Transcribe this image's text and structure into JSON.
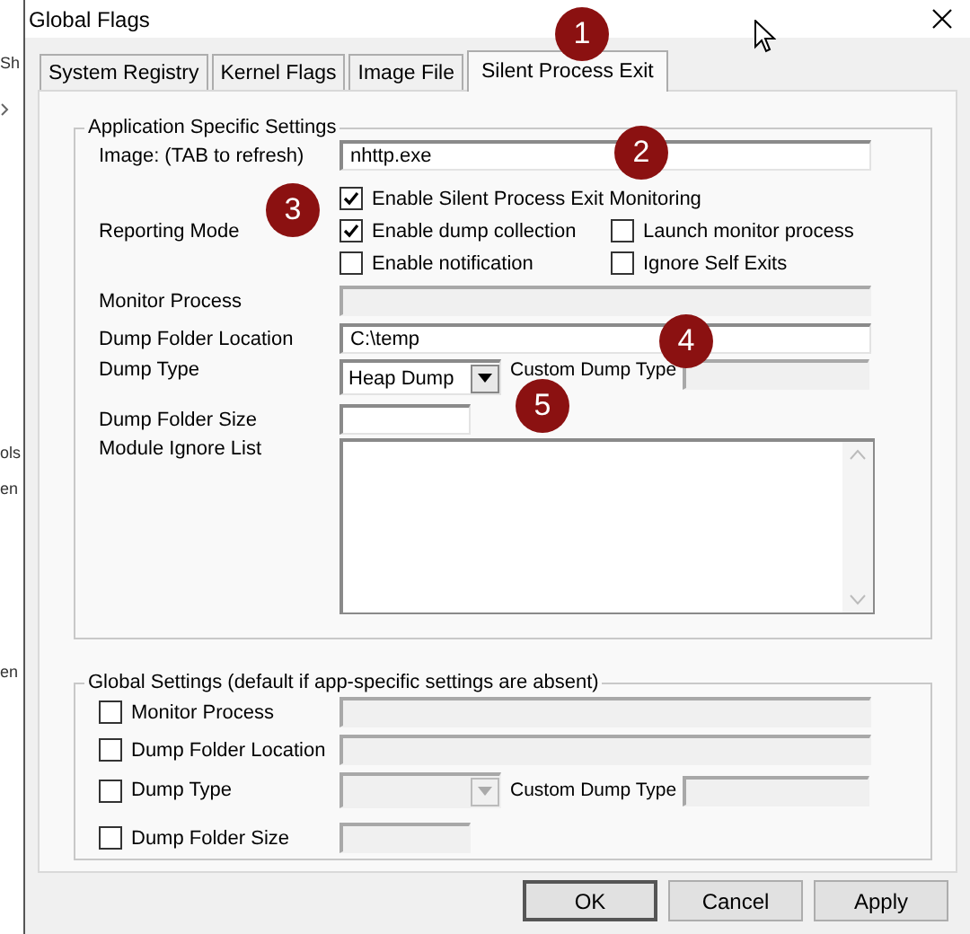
{
  "background_window": {
    "fragments": [
      "Sh",
      "ols",
      "en",
      "en"
    ]
  },
  "window": {
    "title": "Global Flags"
  },
  "tabs": [
    {
      "label": "System Registry",
      "selected": false
    },
    {
      "label": "Kernel Flags",
      "selected": false
    },
    {
      "label": "Image File",
      "selected": false
    },
    {
      "label": "Silent Process Exit",
      "selected": true
    }
  ],
  "app_settings": {
    "title": "Application Specific Settings",
    "image": {
      "label": "Image:  (TAB to refresh)",
      "value": "nhttp.exe",
      "disabled": false
    },
    "reporting_mode": {
      "label": "Reporting Mode",
      "options": [
        {
          "label": "Enable Silent Process Exit Monitoring",
          "checked": true
        },
        {
          "label": "Enable dump collection",
          "checked": true
        },
        {
          "label": "Launch monitor process",
          "checked": false
        },
        {
          "label": "Enable notification",
          "checked": false
        },
        {
          "label": "Ignore Self Exits",
          "checked": false
        }
      ]
    },
    "monitor_process": {
      "label": "Monitor Process",
      "disabled": true
    },
    "dump_folder_location": {
      "label": "Dump Folder Location",
      "value": "C:\\temp",
      "disabled": false
    },
    "dump_type": {
      "label": "Dump Type",
      "value": "Heap Dump",
      "disabled": false
    },
    "custom_dump_type": {
      "label": "Custom Dump Type",
      "disabled": true
    },
    "dump_folder_size": {
      "label": "Dump Folder Size",
      "disabled": false
    },
    "module_ignore_list": {
      "label": "Module Ignore List"
    }
  },
  "global_settings": {
    "title": "Global Settings (default if app-specific settings are absent)",
    "rows": [
      {
        "kind": "text",
        "label": "Monitor Process",
        "checked": false,
        "disabled": true
      },
      {
        "kind": "text",
        "label": "Dump Folder Location",
        "checked": false,
        "disabled": true
      },
      {
        "kind": "dropdown",
        "label": "Dump Type",
        "checked": false,
        "disabled": true,
        "custom_label": "Custom Dump Type"
      },
      {
        "kind": "size",
        "label": "Dump Folder Size",
        "checked": false,
        "disabled": true
      }
    ]
  },
  "buttons": [
    "OK",
    "Cancel",
    "Apply"
  ],
  "callouts": [
    "1",
    "2",
    "3",
    "4",
    "5"
  ]
}
